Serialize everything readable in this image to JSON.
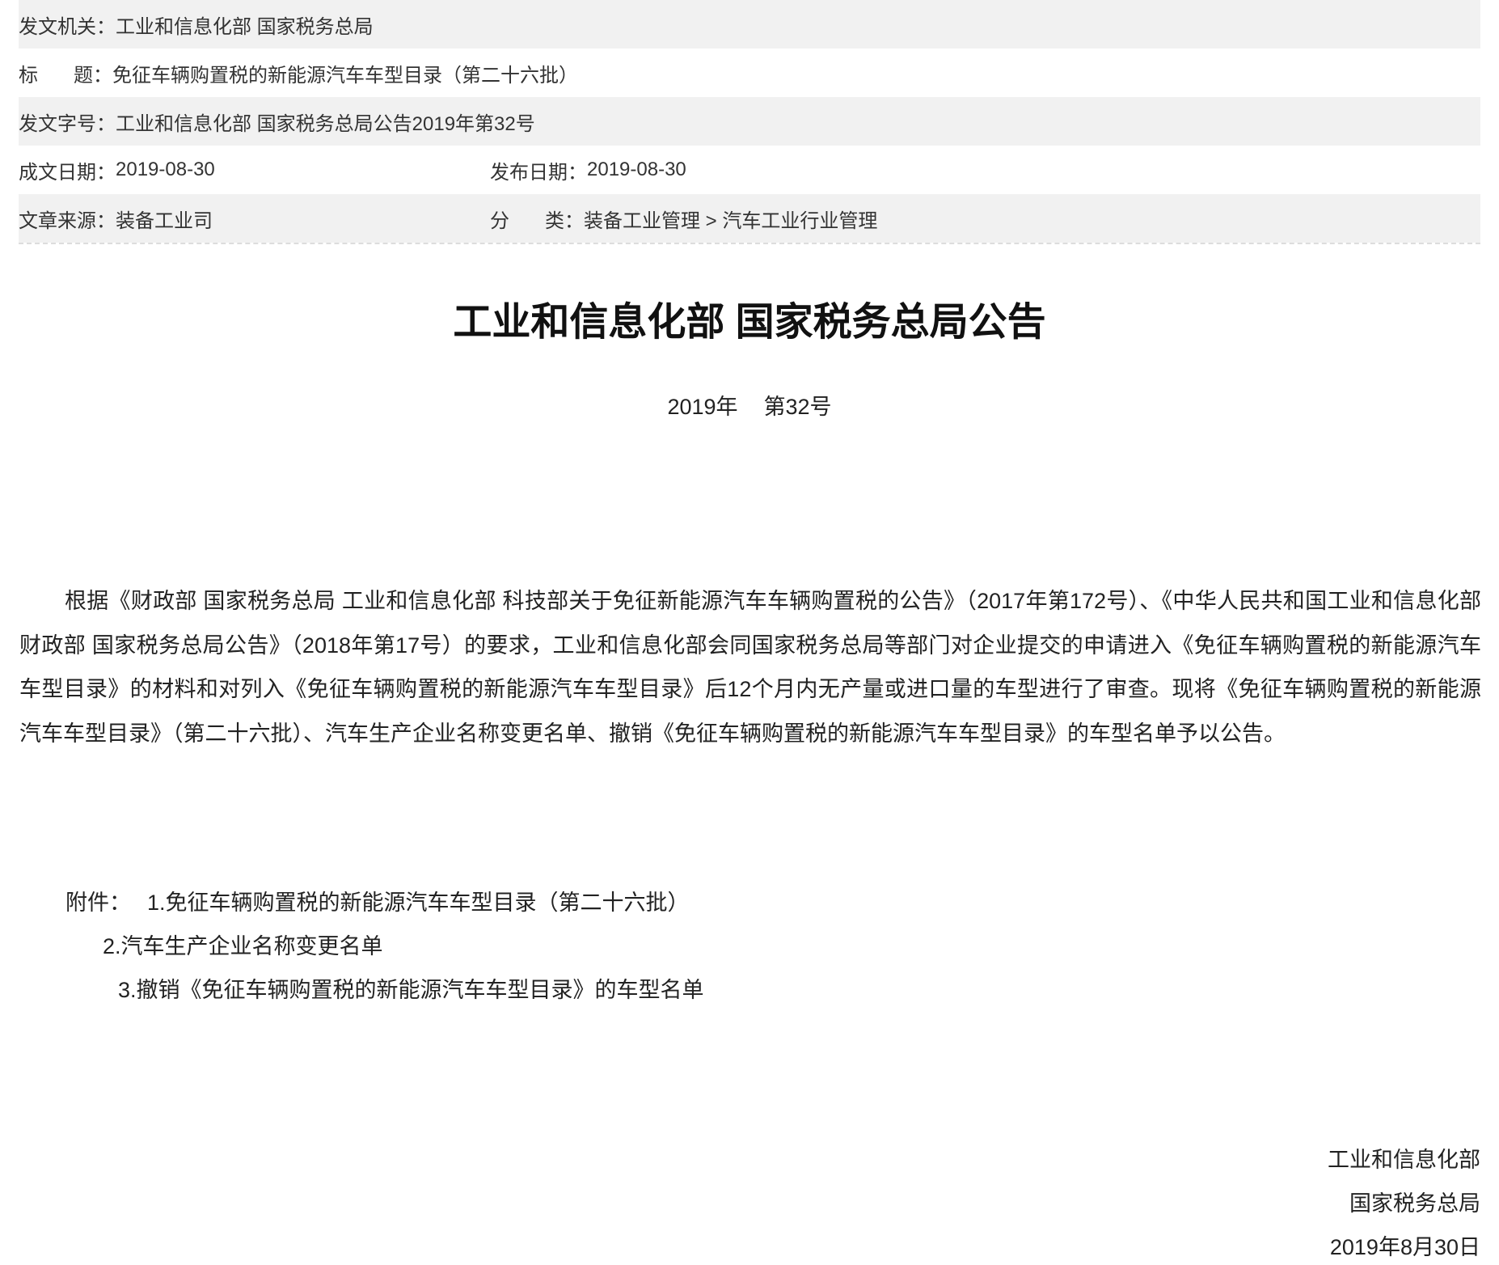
{
  "meta": {
    "issuer_label": "发文机关",
    "issuer": "工业和信息化部 国家税务总局",
    "title_label_1": "标",
    "title_label_2": "题",
    "title": "免征车辆购置税的新能源汽车车型目录（第二十六批）",
    "doc_no_label": "发文字号",
    "doc_no": "工业和信息化部 国家税务总局公告2019年第32号",
    "written_date_label": "成文日期",
    "written_date": "2019-08-30",
    "publish_date_label": "发布日期",
    "publish_date": "2019-08-30",
    "source_label": "文章来源",
    "source": "装备工业司",
    "category_label_1": "分",
    "category_label_2": "类",
    "category": "装备工业管理 > 汽车工业行业管理",
    "colon": "："
  },
  "document": {
    "heading": "工业和信息化部 国家税务总局公告",
    "year": "2019年",
    "number": "第32号",
    "body": "根据《财政部 国家税务总局 工业和信息化部 科技部关于免征新能源汽车车辆购置税的公告》（2017年第172号）、《中华人民共和国工业和信息化部 财政部 国家税务总局公告》（2018年第17号）的要求，工业和信息化部会同国家税务总局等部门对企业提交的申请进入《免征车辆购置税的新能源汽车车型目录》的材料和对列入《免征车辆购置税的新能源汽车车型目录》后12个月内无产量或进口量的车型进行了审查。现将《免征车辆购置税的新能源汽车车型目录》（第二十六批）、汽车生产企业名称变更名单、撤销《免征车辆购置税的新能源汽车车型目录》的车型名单予以公告。",
    "attachments_label": "附件：",
    "attachments": [
      "1.免征车辆购置税的新能源汽车车型目录（第二十六批）",
      "2.汽车生产企业名称变更名单",
      "3.撤销《免征车辆购置税的新能源汽车车型目录》的车型名单"
    ],
    "signatures": [
      "工业和信息化部",
      "国家税务总局",
      "2019年8月30日"
    ]
  }
}
